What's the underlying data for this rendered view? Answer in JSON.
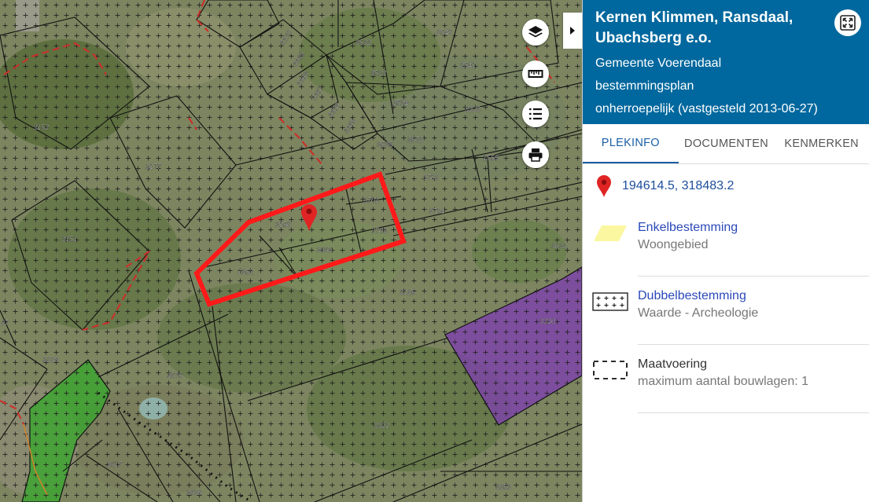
{
  "plan": {
    "title": "Kernen Klimmen, Ransdaal, Ubachsberg e.o.",
    "municipality": "Gemeente Voerendaal",
    "type": "bestemmingsplan",
    "status": "onherroepelijk (vastgesteld 2013-06-27)"
  },
  "tabs": [
    {
      "label": "PLEKINFO",
      "active": true
    },
    {
      "label": "DOCUMENTEN",
      "active": false
    },
    {
      "label": "KENMERKEN",
      "active": false
    }
  ],
  "location": {
    "coordinates": "194614.5, 318483.2",
    "icon": "map-pin-icon",
    "color": "#e02424"
  },
  "legend": [
    {
      "title": "Enkelbestemming",
      "value": "Woongebied",
      "symbol": "yellow-parallelogram",
      "color": "#fbf7a0",
      "link": true
    },
    {
      "title": "Dubbelbestemming",
      "value": "Waarde - Archeologie",
      "symbol": "cross-hatch-box",
      "link": true
    },
    {
      "title": "Maatvoering",
      "value": "maximum aantal bouwlagen: 1",
      "symbol": "dashed-box",
      "link": false
    }
  ],
  "map_controls": [
    "layers-icon",
    "ruler-icon",
    "legend-list-icon",
    "print-icon"
  ],
  "colors": {
    "header": "#00689e",
    "selection": "#ff1a1a",
    "green_zone": "#3aa52e",
    "purple_zone": "#7d3fae"
  },
  "parcel_labels": [
    "3370",
    "3369",
    "3368",
    "3367",
    "3366",
    "3365",
    "3532",
    "3533",
    "3534",
    "3535",
    "3572",
    "2540",
    "2541",
    "3222",
    "3152",
    "3177",
    "3151",
    "1555",
    "3702",
    "3701",
    "3703",
    "3704",
    "3150",
    "3666",
    "1352",
    "2125",
    "3032",
    "3320",
    "3228",
    "3675",
    "3321",
    "3617",
    "3630",
    "3353",
    "27"
  ]
}
